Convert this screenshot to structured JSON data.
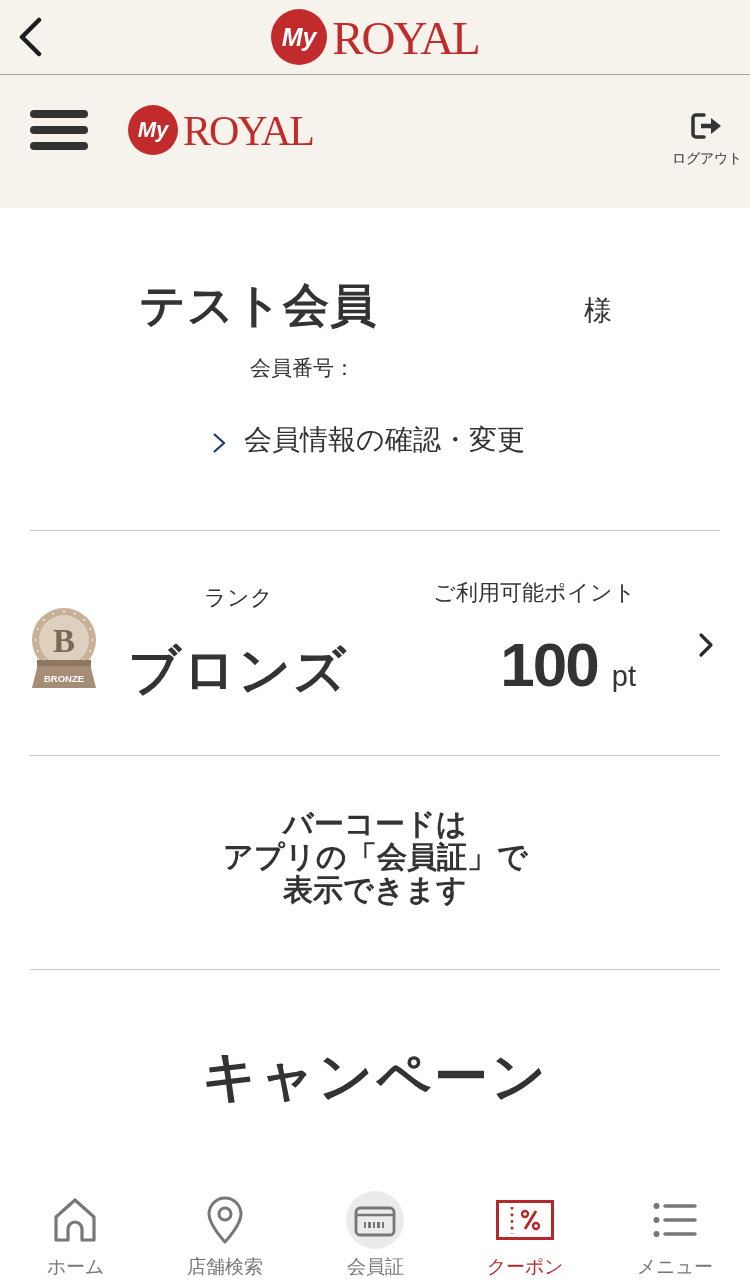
{
  "top_bar": {
    "logo": {
      "badge": "My",
      "word": "ROYAL"
    }
  },
  "header": {
    "logo": {
      "badge": "My",
      "word": "ROYAL"
    },
    "logout_label": "ログアウト"
  },
  "member": {
    "name": "テスト会員",
    "honorific": "様",
    "number_label": "会員番号：",
    "profile_link": "会員情報の確認・変更"
  },
  "status": {
    "rank_label": "ランク",
    "rank": "ブロンズ",
    "medal_letter": "B",
    "medal_text": "BRONZE",
    "points_label": "ご利用可能ポイント",
    "points": "100",
    "points_unit": "pt"
  },
  "notice": {
    "lines": [
      "バーコードは",
      "アプリの「会員証」で",
      "表示できます"
    ]
  },
  "campaign": {
    "title": "キャンペーン"
  },
  "bottom_nav": [
    {
      "label": "ホーム",
      "selected": false
    },
    {
      "label": "店舗検索",
      "selected": false
    },
    {
      "label": "会員証",
      "selected": false
    },
    {
      "label": "クーポン",
      "selected": true
    },
    {
      "label": "メニュー",
      "selected": false
    }
  ]
}
